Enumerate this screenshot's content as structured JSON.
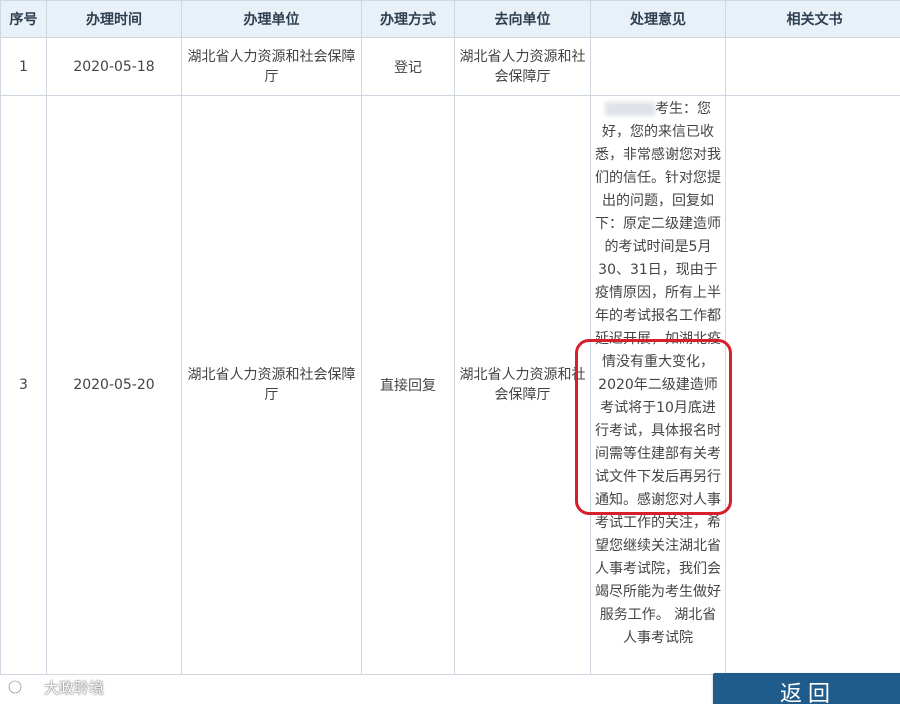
{
  "table": {
    "headers": [
      "序号",
      "办理时间",
      "办理单位",
      "办理方式",
      "去向单位",
      "处理意见",
      "相关文书"
    ],
    "rows": [
      {
        "index": "1",
        "date": "2020-05-18",
        "unit": "湖北省人力资源和社会保障厅",
        "method": "登记",
        "destination": "湖北省人力资源和社会保障厅",
        "opinion": "",
        "documents": ""
      },
      {
        "index": "3",
        "date": "2020-05-20",
        "unit": "湖北省人力资源和社会保障厅",
        "method": "直接回复",
        "destination": "湖北省人力资源和社会保障厅",
        "opinion": "考生：您好，您的来信已收悉，非常感谢您对我们的信任。针对您提出的问题，回复如下：原定二级建造师的考试时间是5月30、31日，现由于疫情原因，所有上半年的考试报名工作都延迟开展，如湖北疫情没有重大变化，2020年二级建造师考试将于10月底进行考试，具体报名时间需等住建部有关考试文件下发后再另行通知。感谢您对人事考试工作的关注，希望您继续关注湖北省人事考试院，我们会竭尽所能为考生做好服务工作。 湖北省人事考试院",
        "documents": ""
      }
    ]
  },
  "highlight_color": "#d6202c",
  "return_button": {
    "label": "返回"
  },
  "watermark": {
    "text": "大政聆境"
  }
}
